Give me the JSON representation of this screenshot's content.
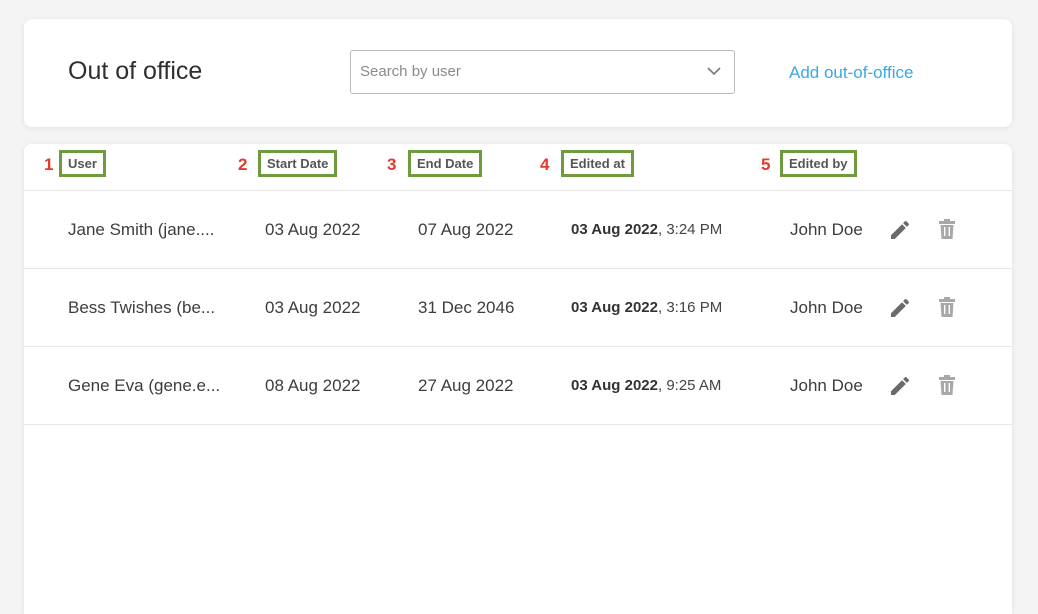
{
  "header": {
    "title": "Out of office",
    "search_placeholder": "Search by user",
    "add_link": "Add out-of-office"
  },
  "columns": [
    {
      "marker": "1",
      "label": "User"
    },
    {
      "marker": "2",
      "label": "Start Date"
    },
    {
      "marker": "3",
      "label": "End Date"
    },
    {
      "marker": "4",
      "label": "Edited at"
    },
    {
      "marker": "5",
      "label": "Edited by"
    }
  ],
  "rows": [
    {
      "user": "Jane Smith (jane....",
      "start": "03 Aug 2022",
      "end": "07 Aug 2022",
      "edited_date": "03 Aug 2022",
      "edited_time": ", 3:24 PM",
      "edited_by": "John Doe"
    },
    {
      "user": "Bess Twishes (be...",
      "start": "03 Aug 2022",
      "end": "31 Dec 2046",
      "edited_date": "03 Aug 2022",
      "edited_time": ", 3:16 PM",
      "edited_by": "John Doe"
    },
    {
      "user": "Gene Eva (gene.e...",
      "start": "08 Aug 2022",
      "end": "27 Aug 2022",
      "edited_date": "03 Aug 2022",
      "edited_time": ", 9:25 AM",
      "edited_by": "John Doe"
    }
  ],
  "icons": {
    "chevron": "chevron-down-icon",
    "edit": "pencil-icon",
    "delete": "trash-icon"
  },
  "colors": {
    "link": "#3aa8e3",
    "column_highlight": "#6f9a3f",
    "marker": "#e23b2e",
    "icon": "#6a6a6a",
    "delete_icon": "#a8a8a8"
  }
}
